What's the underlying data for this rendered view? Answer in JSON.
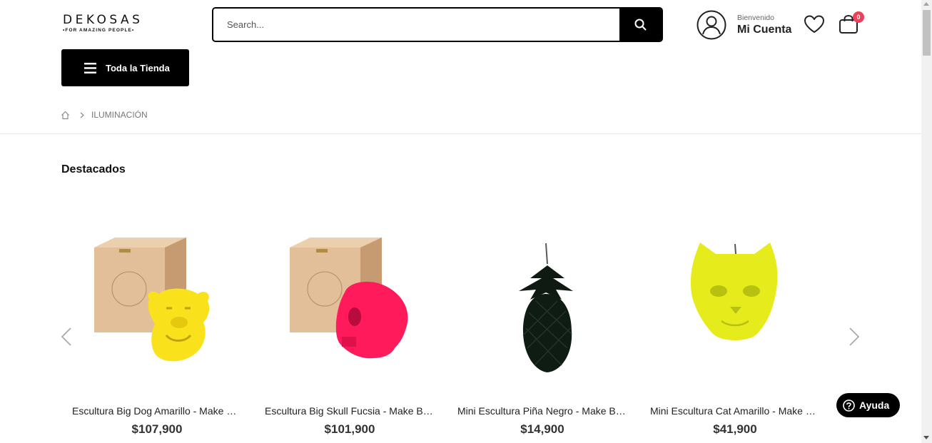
{
  "header": {
    "logo_main": "DEKOSAS",
    "logo_sub": "•FOR AMAZING PEOPLE•",
    "search_placeholder": "Search...",
    "account_greeting": "Bienvenido",
    "account_label": "Mi Cuenta",
    "cart_count": "0",
    "cart_badge_color": "#ef3f5a"
  },
  "nav": {
    "store_button": "Toda la Tienda"
  },
  "breadcrumb": {
    "current": "ILUMINACIÓN"
  },
  "section": {
    "title": "Destacados"
  },
  "products": [
    {
      "name": "Escultura Big Dog Amarillo - Make Burn",
      "price": "$107,900",
      "image": "yellow-dog-sculpture-with-wood-box"
    },
    {
      "name": "Escultura Big Skull Fucsia - Make Burn",
      "price": "$101,900",
      "image": "fuchsia-skull-sculpture-with-wood-box"
    },
    {
      "name": "Mini Escultura Piña Negro - Make Burn",
      "price": "$14,900",
      "image": "black-pineapple-candle"
    },
    {
      "name": "Mini Escultura Cat Amarillo - Make Burn",
      "price": "$41,900",
      "image": "yellow-cat-head-candle"
    }
  ],
  "help": {
    "label": "Ayuda"
  },
  "icons": {
    "search": "search-icon",
    "account": "user-icon",
    "wishlist": "heart-icon",
    "cart": "shopping-bag-icon",
    "menu": "hamburger-icon",
    "home": "home-icon",
    "help": "question-icon",
    "prev": "chevron-left-icon",
    "next": "chevron-right-icon"
  }
}
